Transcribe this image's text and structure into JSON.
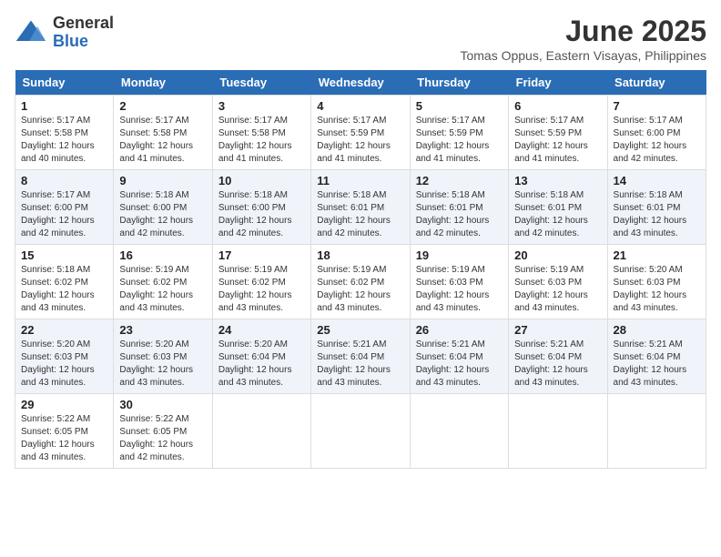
{
  "logo": {
    "general": "General",
    "blue": "Blue"
  },
  "title": {
    "month": "June 2025",
    "location": "Tomas Oppus, Eastern Visayas, Philippines"
  },
  "weekdays": [
    "Sunday",
    "Monday",
    "Tuesday",
    "Wednesday",
    "Thursday",
    "Friday",
    "Saturday"
  ],
  "weeks": [
    [
      {
        "day": "1",
        "sunrise": "5:17 AM",
        "sunset": "5:58 PM",
        "daylight": "12 hours and 40 minutes."
      },
      {
        "day": "2",
        "sunrise": "5:17 AM",
        "sunset": "5:58 PM",
        "daylight": "12 hours and 41 minutes."
      },
      {
        "day": "3",
        "sunrise": "5:17 AM",
        "sunset": "5:58 PM",
        "daylight": "12 hours and 41 minutes."
      },
      {
        "day": "4",
        "sunrise": "5:17 AM",
        "sunset": "5:59 PM",
        "daylight": "12 hours and 41 minutes."
      },
      {
        "day": "5",
        "sunrise": "5:17 AM",
        "sunset": "5:59 PM",
        "daylight": "12 hours and 41 minutes."
      },
      {
        "day": "6",
        "sunrise": "5:17 AM",
        "sunset": "5:59 PM",
        "daylight": "12 hours and 41 minutes."
      },
      {
        "day": "7",
        "sunrise": "5:17 AM",
        "sunset": "6:00 PM",
        "daylight": "12 hours and 42 minutes."
      }
    ],
    [
      {
        "day": "8",
        "sunrise": "5:17 AM",
        "sunset": "6:00 PM",
        "daylight": "12 hours and 42 minutes."
      },
      {
        "day": "9",
        "sunrise": "5:18 AM",
        "sunset": "6:00 PM",
        "daylight": "12 hours and 42 minutes."
      },
      {
        "day": "10",
        "sunrise": "5:18 AM",
        "sunset": "6:00 PM",
        "daylight": "12 hours and 42 minutes."
      },
      {
        "day": "11",
        "sunrise": "5:18 AM",
        "sunset": "6:01 PM",
        "daylight": "12 hours and 42 minutes."
      },
      {
        "day": "12",
        "sunrise": "5:18 AM",
        "sunset": "6:01 PM",
        "daylight": "12 hours and 42 minutes."
      },
      {
        "day": "13",
        "sunrise": "5:18 AM",
        "sunset": "6:01 PM",
        "daylight": "12 hours and 42 minutes."
      },
      {
        "day": "14",
        "sunrise": "5:18 AM",
        "sunset": "6:01 PM",
        "daylight": "12 hours and 43 minutes."
      }
    ],
    [
      {
        "day": "15",
        "sunrise": "5:18 AM",
        "sunset": "6:02 PM",
        "daylight": "12 hours and 43 minutes."
      },
      {
        "day": "16",
        "sunrise": "5:19 AM",
        "sunset": "6:02 PM",
        "daylight": "12 hours and 43 minutes."
      },
      {
        "day": "17",
        "sunrise": "5:19 AM",
        "sunset": "6:02 PM",
        "daylight": "12 hours and 43 minutes."
      },
      {
        "day": "18",
        "sunrise": "5:19 AM",
        "sunset": "6:02 PM",
        "daylight": "12 hours and 43 minutes."
      },
      {
        "day": "19",
        "sunrise": "5:19 AM",
        "sunset": "6:03 PM",
        "daylight": "12 hours and 43 minutes."
      },
      {
        "day": "20",
        "sunrise": "5:19 AM",
        "sunset": "6:03 PM",
        "daylight": "12 hours and 43 minutes."
      },
      {
        "day": "21",
        "sunrise": "5:20 AM",
        "sunset": "6:03 PM",
        "daylight": "12 hours and 43 minutes."
      }
    ],
    [
      {
        "day": "22",
        "sunrise": "5:20 AM",
        "sunset": "6:03 PM",
        "daylight": "12 hours and 43 minutes."
      },
      {
        "day": "23",
        "sunrise": "5:20 AM",
        "sunset": "6:03 PM",
        "daylight": "12 hours and 43 minutes."
      },
      {
        "day": "24",
        "sunrise": "5:20 AM",
        "sunset": "6:04 PM",
        "daylight": "12 hours and 43 minutes."
      },
      {
        "day": "25",
        "sunrise": "5:21 AM",
        "sunset": "6:04 PM",
        "daylight": "12 hours and 43 minutes."
      },
      {
        "day": "26",
        "sunrise": "5:21 AM",
        "sunset": "6:04 PM",
        "daylight": "12 hours and 43 minutes."
      },
      {
        "day": "27",
        "sunrise": "5:21 AM",
        "sunset": "6:04 PM",
        "daylight": "12 hours and 43 minutes."
      },
      {
        "day": "28",
        "sunrise": "5:21 AM",
        "sunset": "6:04 PM",
        "daylight": "12 hours and 43 minutes."
      }
    ],
    [
      {
        "day": "29",
        "sunrise": "5:22 AM",
        "sunset": "6:05 PM",
        "daylight": "12 hours and 43 minutes."
      },
      {
        "day": "30",
        "sunrise": "5:22 AM",
        "sunset": "6:05 PM",
        "daylight": "12 hours and 42 minutes."
      },
      null,
      null,
      null,
      null,
      null
    ]
  ],
  "labels": {
    "sunrise": "Sunrise:",
    "sunset": "Sunset:",
    "daylight": "Daylight:"
  }
}
